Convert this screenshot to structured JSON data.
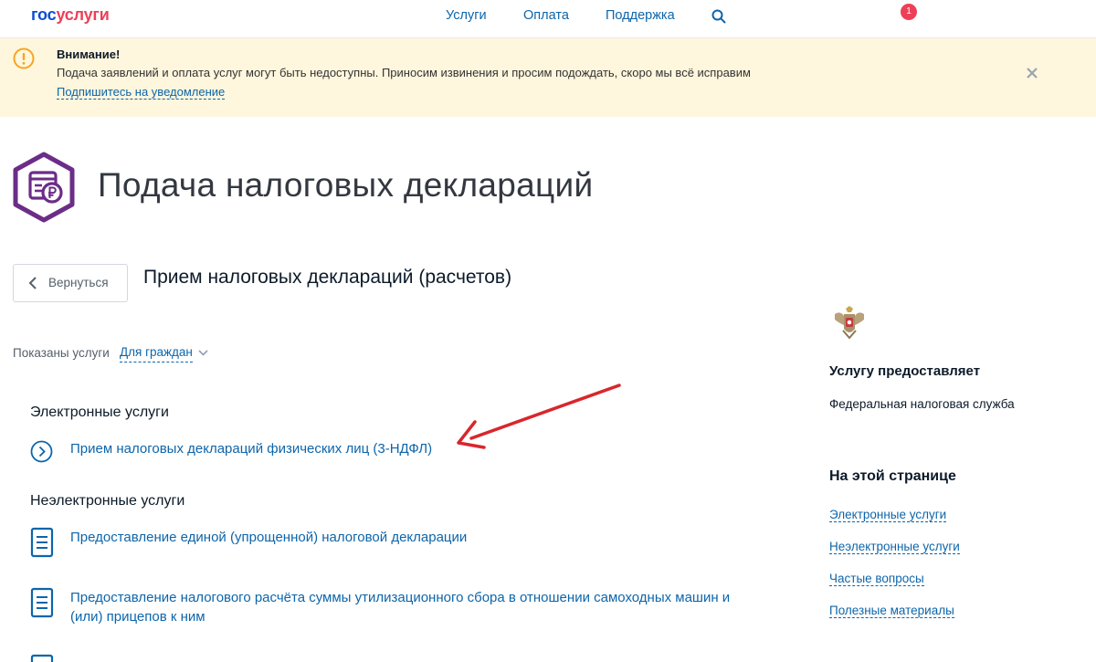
{
  "header": {
    "logo_part1": "гос",
    "logo_part2": "услуги",
    "nav": [
      "Услуги",
      "Оплата",
      "Поддержка"
    ],
    "notification_count": "1"
  },
  "alert": {
    "title": "Внимание!",
    "text": "Подача заявлений и оплата услуг могут быть недоступны. Приносим извинения и просим подождать, скоро мы всё исправим",
    "link": "Подпишитесь на уведомление"
  },
  "page": {
    "title": "Подача налоговых деклараций",
    "back_label": "Вернуться",
    "subtitle": "Прием налоговых деклараций (расчетов)"
  },
  "filter": {
    "label": "Показаны услуги",
    "value": "Для граждан"
  },
  "electronic": {
    "title": "Электронные услуги",
    "items": [
      "Прием налоговых деклараций физических лиц (3-НДФЛ)"
    ]
  },
  "non_electronic": {
    "title": "Неэлектронные услуги",
    "items": [
      "Предоставление единой (упрощенной) налоговой декларации",
      "Предоставление налогового расчёта суммы утилизационного сбора в отношении самоходных машин и (или) прицепов к ним"
    ]
  },
  "sidebar": {
    "provider_heading": "Услугу предоставляет",
    "provider_name": "Федеральная налоговая служба",
    "on_page_heading": "На этой странице",
    "links": [
      "Электронные услуги",
      "Неэлектронные услуги",
      "Частые вопросы",
      "Полезные материалы"
    ]
  },
  "colors": {
    "link": "#0d65aa",
    "brand_blue": "#0d4cd3",
    "brand_red": "#ee3f58",
    "alert_bg": "#fef6dd",
    "icon_purple": "#6b2d87",
    "arrow_red": "#d9262c"
  }
}
